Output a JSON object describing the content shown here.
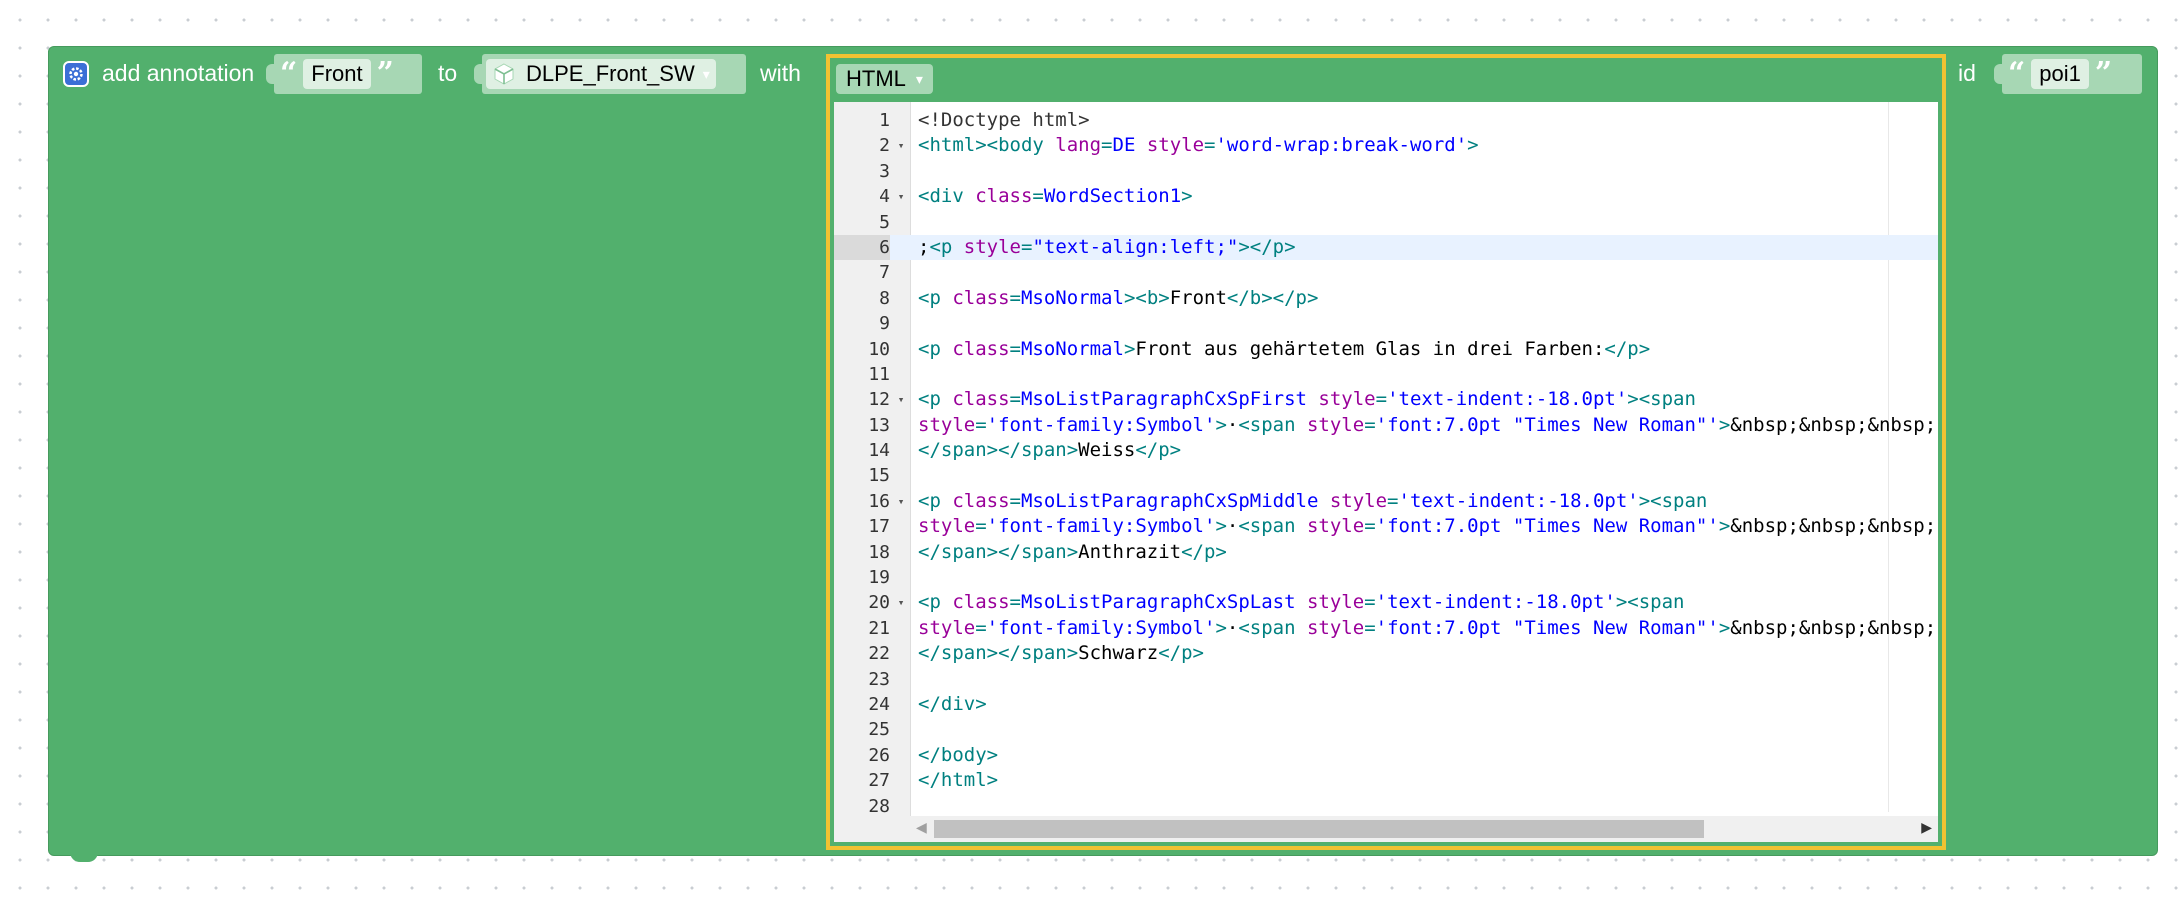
{
  "block": {
    "label_add_annotation": "add annotation",
    "label_to": "to",
    "label_with": "with",
    "label_id": "id",
    "annotation_text": "Front",
    "target_value": "DLPE_Front_SW",
    "language_value": "HTML",
    "id_value": "poi1",
    "open_quote": "“",
    "close_quote": "”"
  },
  "editor": {
    "lines": [
      {
        "n": "1",
        "fold": "",
        "segs": [
          [
            "d",
            "<!Doctype html>"
          ]
        ]
      },
      {
        "n": "2",
        "fold": "▾",
        "segs": [
          [
            "t",
            "<html><body "
          ],
          [
            "a",
            "lang"
          ],
          [
            "t",
            "="
          ],
          [
            "v",
            "DE"
          ],
          [
            "a",
            " style"
          ],
          [
            "t",
            "="
          ],
          [
            "v",
            "'word-wrap:break-word'"
          ],
          [
            "t",
            ">"
          ]
        ]
      },
      {
        "n": "3",
        "fold": "",
        "segs": []
      },
      {
        "n": "4",
        "fold": "▾",
        "segs": [
          [
            "t",
            "<div "
          ],
          [
            "a",
            "class"
          ],
          [
            "t",
            "="
          ],
          [
            "v",
            "WordSection1"
          ],
          [
            "t",
            ">"
          ]
        ]
      },
      {
        "n": "5",
        "fold": "",
        "segs": []
      },
      {
        "n": "6",
        "fold": "",
        "active": true,
        "segs": [
          [
            "x",
            ";"
          ],
          [
            "t",
            "<p "
          ],
          [
            "a",
            "style"
          ],
          [
            "t",
            "="
          ],
          [
            "v",
            "\"text-align:left;\""
          ],
          [
            "t",
            "></p>"
          ]
        ]
      },
      {
        "n": "7",
        "fold": "",
        "segs": []
      },
      {
        "n": "8",
        "fold": "",
        "segs": [
          [
            "t",
            "<p "
          ],
          [
            "a",
            "class"
          ],
          [
            "t",
            "="
          ],
          [
            "v",
            "MsoNormal"
          ],
          [
            "t",
            "><b>"
          ],
          [
            "x",
            "Front"
          ],
          [
            "t",
            "</b></p>"
          ]
        ]
      },
      {
        "n": "9",
        "fold": "",
        "segs": []
      },
      {
        "n": "10",
        "fold": "",
        "segs": [
          [
            "t",
            "<p "
          ],
          [
            "a",
            "class"
          ],
          [
            "t",
            "="
          ],
          [
            "v",
            "MsoNormal"
          ],
          [
            "t",
            ">"
          ],
          [
            "x",
            "Front aus gehärtetem Glas in drei Farben:"
          ],
          [
            "t",
            "</p>"
          ]
        ]
      },
      {
        "n": "11",
        "fold": "",
        "segs": []
      },
      {
        "n": "12",
        "fold": "▾",
        "segs": [
          [
            "t",
            "<p "
          ],
          [
            "a",
            "class"
          ],
          [
            "t",
            "="
          ],
          [
            "v",
            "MsoListParagraphCxSpFirst"
          ],
          [
            "a",
            " style"
          ],
          [
            "t",
            "="
          ],
          [
            "v",
            "'text-indent:-18.0pt'"
          ],
          [
            "t",
            "><span"
          ]
        ]
      },
      {
        "n": "13",
        "fold": "",
        "segs": [
          [
            "a",
            "style"
          ],
          [
            "t",
            "="
          ],
          [
            "v",
            "'font-family:Symbol'"
          ],
          [
            "t",
            ">"
          ],
          [
            "x",
            "·"
          ],
          [
            "t",
            "<span "
          ],
          [
            "a",
            "style"
          ],
          [
            "t",
            "="
          ],
          [
            "v",
            "'font:7.0pt \"Times New Roman\"'"
          ],
          [
            "t",
            ">"
          ],
          [
            "x",
            "&nbsp;&nbsp;&nbsp;"
          ]
        ]
      },
      {
        "n": "14",
        "fold": "",
        "segs": [
          [
            "t",
            "</span></span>"
          ],
          [
            "x",
            "Weiss"
          ],
          [
            "t",
            "</p>"
          ]
        ]
      },
      {
        "n": "15",
        "fold": "",
        "segs": []
      },
      {
        "n": "16",
        "fold": "▾",
        "segs": [
          [
            "t",
            "<p "
          ],
          [
            "a",
            "class"
          ],
          [
            "t",
            "="
          ],
          [
            "v",
            "MsoListParagraphCxSpMiddle"
          ],
          [
            "a",
            " style"
          ],
          [
            "t",
            "="
          ],
          [
            "v",
            "'text-indent:-18.0pt'"
          ],
          [
            "t",
            "><span"
          ]
        ]
      },
      {
        "n": "17",
        "fold": "",
        "segs": [
          [
            "a",
            "style"
          ],
          [
            "t",
            "="
          ],
          [
            "v",
            "'font-family:Symbol'"
          ],
          [
            "t",
            ">"
          ],
          [
            "x",
            "·"
          ],
          [
            "t",
            "<span "
          ],
          [
            "a",
            "style"
          ],
          [
            "t",
            "="
          ],
          [
            "v",
            "'font:7.0pt \"Times New Roman\"'"
          ],
          [
            "t",
            ">"
          ],
          [
            "x",
            "&nbsp;&nbsp;&nbsp;"
          ]
        ]
      },
      {
        "n": "18",
        "fold": "",
        "segs": [
          [
            "t",
            "</span></span>"
          ],
          [
            "x",
            "Anthrazit"
          ],
          [
            "t",
            "</p>"
          ]
        ]
      },
      {
        "n": "19",
        "fold": "",
        "segs": []
      },
      {
        "n": "20",
        "fold": "▾",
        "segs": [
          [
            "t",
            "<p "
          ],
          [
            "a",
            "class"
          ],
          [
            "t",
            "="
          ],
          [
            "v",
            "MsoListParagraphCxSpLast"
          ],
          [
            "a",
            " style"
          ],
          [
            "t",
            "="
          ],
          [
            "v",
            "'text-indent:-18.0pt'"
          ],
          [
            "t",
            "><span"
          ]
        ]
      },
      {
        "n": "21",
        "fold": "",
        "segs": [
          [
            "a",
            "style"
          ],
          [
            "t",
            "="
          ],
          [
            "v",
            "'font-family:Symbol'"
          ],
          [
            "t",
            ">"
          ],
          [
            "x",
            "·"
          ],
          [
            "t",
            "<span "
          ],
          [
            "a",
            "style"
          ],
          [
            "t",
            "="
          ],
          [
            "v",
            "'font:7.0pt \"Times New Roman\"'"
          ],
          [
            "t",
            ">"
          ],
          [
            "x",
            "&nbsp;&nbsp;&nbsp;"
          ]
        ]
      },
      {
        "n": "22",
        "fold": "",
        "segs": [
          [
            "t",
            "</span></span>"
          ],
          [
            "x",
            "Schwarz"
          ],
          [
            "t",
            "</p>"
          ]
        ]
      },
      {
        "n": "23",
        "fold": "",
        "segs": []
      },
      {
        "n": "24",
        "fold": "",
        "segs": [
          [
            "t",
            "</div>"
          ]
        ]
      },
      {
        "n": "25",
        "fold": "",
        "segs": []
      },
      {
        "n": "26",
        "fold": "",
        "segs": [
          [
            "t",
            "</body>"
          ]
        ]
      },
      {
        "n": "27",
        "fold": "",
        "segs": [
          [
            "t",
            "</html>"
          ]
        ]
      },
      {
        "n": "28",
        "fold": "",
        "segs": []
      }
    ]
  },
  "colors": {
    "block_green": "#52b06d",
    "pill_green": "#a7d7b4",
    "selection_yellow": "#f1c232",
    "gear_blue": "#3b6fd6",
    "tag": "#008080",
    "attr": "#990099",
    "value": "#0000ff"
  },
  "icons": {
    "settings": "gear-icon",
    "object": "cube-icon",
    "dropdown": "triangle-down-icon"
  }
}
